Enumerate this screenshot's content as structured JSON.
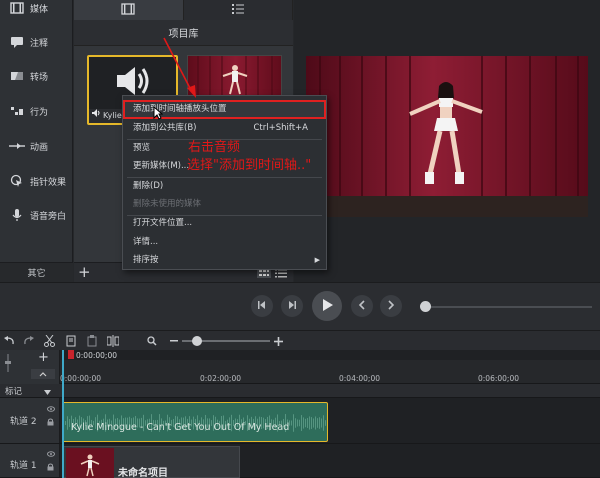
{
  "sidebar": {
    "items": [
      {
        "label": "媒体",
        "icon": "film-icon"
      },
      {
        "label": "注释",
        "icon": "callout-icon"
      },
      {
        "label": "转场",
        "icon": "transition-icon"
      },
      {
        "label": "行为",
        "icon": "behavior-icon"
      },
      {
        "label": "动画",
        "icon": "animation-icon"
      },
      {
        "label": "指针效果",
        "icon": "cursor-effect-icon"
      },
      {
        "label": "语音旁白",
        "icon": "microphone-icon"
      }
    ],
    "other_label": "其它",
    "add_label": "+"
  },
  "bin": {
    "title": "项目库",
    "audio_caption": "Kylie",
    "tabs": [
      "film-icon",
      "list-icon"
    ]
  },
  "context_menu": {
    "items": [
      {
        "label": "添加到时间轴播放头位置",
        "shortcut": ""
      },
      {
        "label": "添加到公共库(B)",
        "shortcut": "Ctrl+Shift+A"
      },
      {
        "label": "预览",
        "shortcut": ""
      },
      {
        "label": "更新媒体(M)...",
        "shortcut": ""
      },
      {
        "label": "删除(D)",
        "shortcut": ""
      },
      {
        "label": "删除未使用的媒体",
        "shortcut": "",
        "disabled": true
      },
      {
        "label": "打开文件位置...",
        "shortcut": ""
      },
      {
        "label": "详情...",
        "shortcut": ""
      },
      {
        "label": "排序按",
        "shortcut": "",
        "submenu": true
      }
    ]
  },
  "annotations": {
    "line1": "右击音频",
    "line2": "选择\"添加到时间轴..\""
  },
  "timeline": {
    "playhead_time": "0:00:00;00",
    "ticks": [
      "0:00:00;00",
      "0:02:00;00",
      "0:04:00;00",
      "0:06:00;00"
    ],
    "markers_label": "标记",
    "tracks": [
      {
        "label": "轨道 2",
        "clip": "Kylie Minogue - Can't Get You Out Of My Head"
      },
      {
        "label": "轨道 1",
        "clip": "未命名项目"
      }
    ]
  },
  "colors": {
    "selection": "#e5b82a",
    "annotation": "#e01818",
    "audio_clip": "#2e6d5b",
    "playhead": "#3fa9c9"
  }
}
